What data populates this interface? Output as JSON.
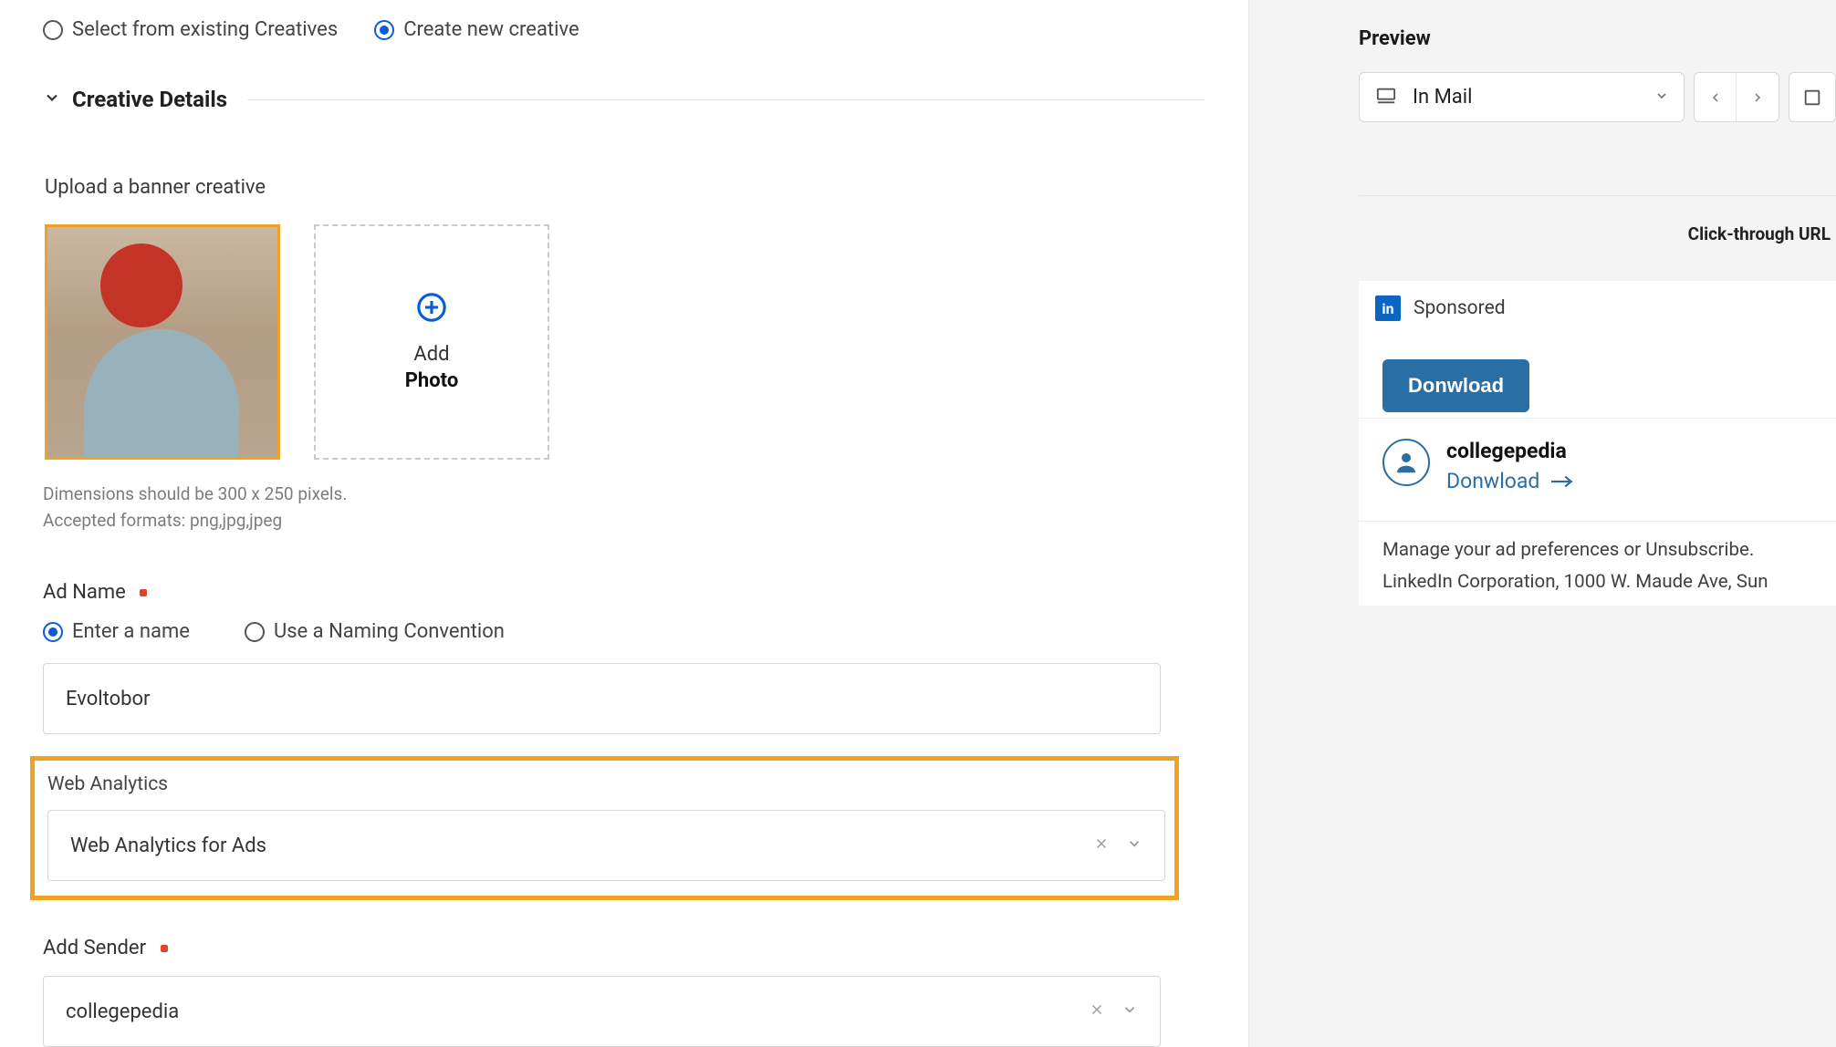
{
  "creative_source": {
    "select_existing_label": "Select from existing Creatives",
    "create_new_label": "Create new creative",
    "selected": "create_new"
  },
  "section": {
    "title": "Creative Details"
  },
  "upload": {
    "label": "Upload a banner creative",
    "add_line1": "Add",
    "add_line2": "Photo",
    "dimensions_note_line1": "Dimensions should be 300 x 250 pixels.",
    "dimensions_note_line2": "Accepted formats: png,jpg,jpeg"
  },
  "ad_name": {
    "label": "Ad Name",
    "option_enter": "Enter a name",
    "option_convention": "Use a Naming Convention",
    "value": "Evoltobor"
  },
  "web_analytics": {
    "label": "Web Analytics",
    "value": "Web Analytics for Ads"
  },
  "add_sender": {
    "label": "Add Sender",
    "value": "collegepedia"
  },
  "preview": {
    "title": "Preview",
    "select_label": "In Mail",
    "click_through_label": "Click-through URL",
    "sponsored_label": "Sponsored",
    "cta_button": "Donwload",
    "profile_name": "collegepedia",
    "profile_link": "Donwload",
    "manage_line1": "Manage your ad preferences or Unsubscribe.",
    "manage_line2": "LinkedIn Corporation, 1000 W. Maude Ave, Sun"
  }
}
